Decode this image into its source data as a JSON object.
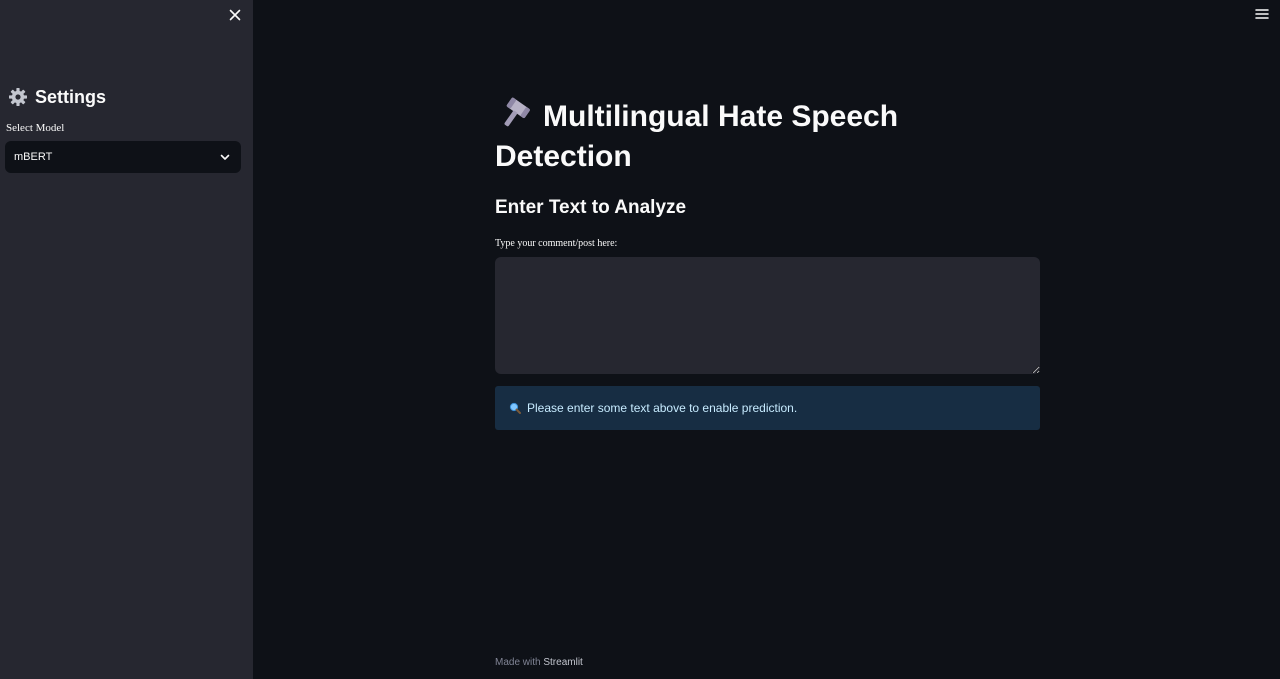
{
  "sidebar": {
    "heading": "Settings",
    "select_label": "Select Model",
    "select_value": "mBERT",
    "icons": {
      "close": "close-icon",
      "settings": "gear-icon",
      "dropdown": "chevron-down-icon"
    }
  },
  "header": {
    "menu_icon": "hamburger-menu-icon"
  },
  "main": {
    "title": "Multilingual Hate Speech Detection",
    "title_icon": "gavel-emoji-icon",
    "subheader": "Enter Text to Analyze",
    "input_label": "Type your comment/post here:",
    "input_value": "",
    "info_icon": "magnifier-icon",
    "info_message": "Please enter some text above to enable prediction."
  },
  "footer": {
    "prefix": "Made with",
    "brand": "Streamlit"
  },
  "colors": {
    "background": "#0e1117",
    "sidebar": "#262730",
    "input_bg": "#262730",
    "info_bg": "#172d43",
    "info_text": "#c7ebff",
    "text": "#fafafa"
  }
}
